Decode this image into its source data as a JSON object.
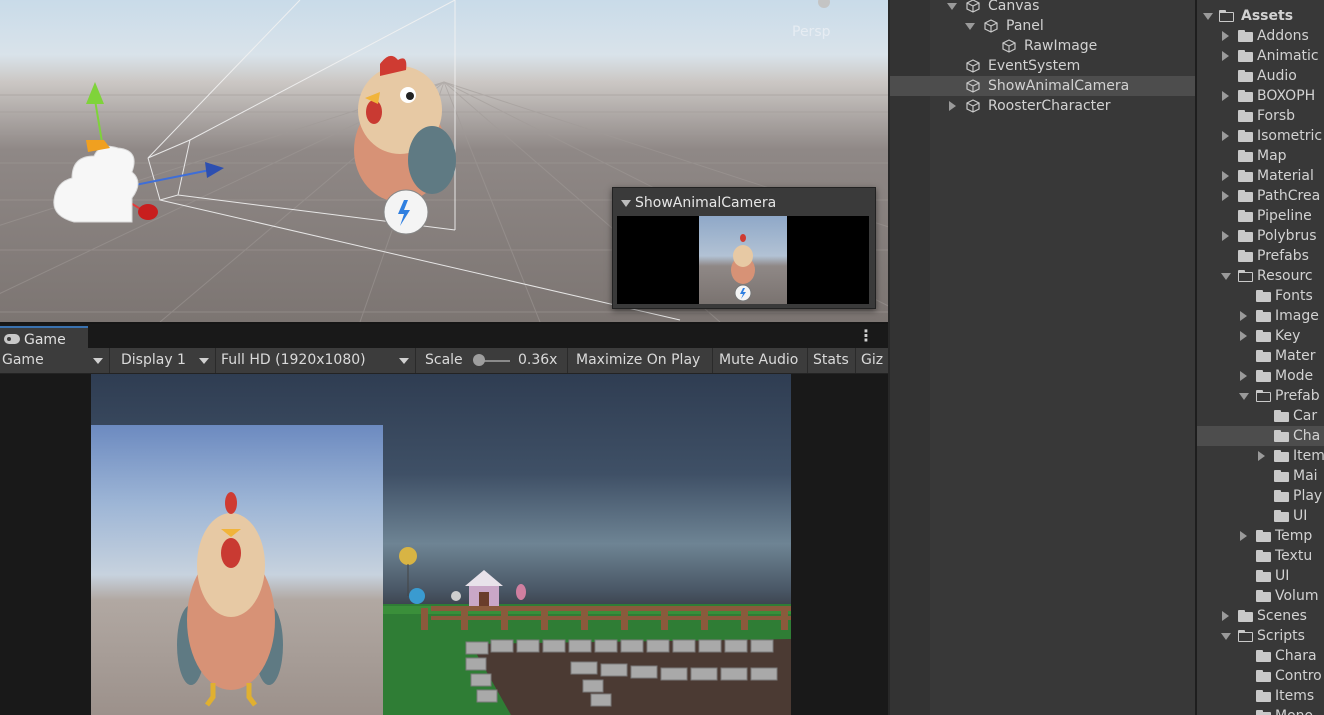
{
  "scene_view": {
    "persp_label": "Persp",
    "camera_preview": {
      "title": "ShowAnimalCamera"
    }
  },
  "game_view": {
    "tab_label": "Game",
    "toolbar": {
      "view_mode": "Game",
      "display": "Display 1",
      "resolution": "Full HD (1920x1080)",
      "scale_label": "Scale",
      "scale_value": "0.36x",
      "scale_fraction": 0.1,
      "maximize": "Maximize On Play",
      "mute": "Mute Audio",
      "stats": "Stats",
      "gizmos": "Giz"
    }
  },
  "hierarchy": {
    "items": [
      {
        "label": "Canvas",
        "depth": 0,
        "expanded": true
      },
      {
        "label": "Panel",
        "depth": 1,
        "expanded": true
      },
      {
        "label": "RawImage",
        "depth": 2
      },
      {
        "label": "EventSystem",
        "depth": 0
      },
      {
        "label": "ShowAnimalCamera",
        "depth": 0,
        "selected": true
      },
      {
        "label": "RoosterCharacter",
        "depth": 0,
        "expanded": false
      }
    ]
  },
  "project": {
    "root": "Assets",
    "items": [
      {
        "label": "Addons",
        "depth": 0,
        "arrow": "right"
      },
      {
        "label": "Animatic",
        "depth": 0,
        "arrow": "right"
      },
      {
        "label": "Audio",
        "depth": 0
      },
      {
        "label": "BOXOPH",
        "depth": 0,
        "arrow": "right"
      },
      {
        "label": "Forsb",
        "depth": 0
      },
      {
        "label": "Isometric",
        "depth": 0,
        "arrow": "right"
      },
      {
        "label": "Map",
        "depth": 0
      },
      {
        "label": "Material",
        "depth": 0,
        "arrow": "right"
      },
      {
        "label": "PathCrea",
        "depth": 0,
        "arrow": "right"
      },
      {
        "label": "Pipeline",
        "depth": 0
      },
      {
        "label": "Polybrus",
        "depth": 0,
        "arrow": "right"
      },
      {
        "label": "Prefabs",
        "depth": 0
      },
      {
        "label": "Resourc",
        "depth": 0,
        "arrow": "down"
      },
      {
        "label": "Fonts",
        "depth": 1
      },
      {
        "label": "Image",
        "depth": 1,
        "arrow": "right"
      },
      {
        "label": "Key",
        "depth": 1,
        "arrow": "right"
      },
      {
        "label": "Mater",
        "depth": 1
      },
      {
        "label": "Mode",
        "depth": 1,
        "arrow": "right"
      },
      {
        "label": "Prefab",
        "depth": 1,
        "arrow": "down"
      },
      {
        "label": "Car",
        "depth": 2
      },
      {
        "label": "Cha",
        "depth": 2,
        "selected": true
      },
      {
        "label": "Item",
        "depth": 2,
        "arrow": "right"
      },
      {
        "label": "Mai",
        "depth": 2
      },
      {
        "label": "Play",
        "depth": 2
      },
      {
        "label": "UI",
        "depth": 2
      },
      {
        "label": "Temp",
        "depth": 1,
        "arrow": "right"
      },
      {
        "label": "Textu",
        "depth": 1
      },
      {
        "label": "UI",
        "depth": 1
      },
      {
        "label": "Volum",
        "depth": 1
      },
      {
        "label": "Scenes",
        "depth": 0,
        "arrow": "right"
      },
      {
        "label": "Scripts",
        "depth": 0,
        "arrow": "down"
      },
      {
        "label": "Chara",
        "depth": 1
      },
      {
        "label": "Contro",
        "depth": 1
      },
      {
        "label": "Items",
        "depth": 1
      },
      {
        "label": "Mono",
        "depth": 1
      }
    ]
  }
}
